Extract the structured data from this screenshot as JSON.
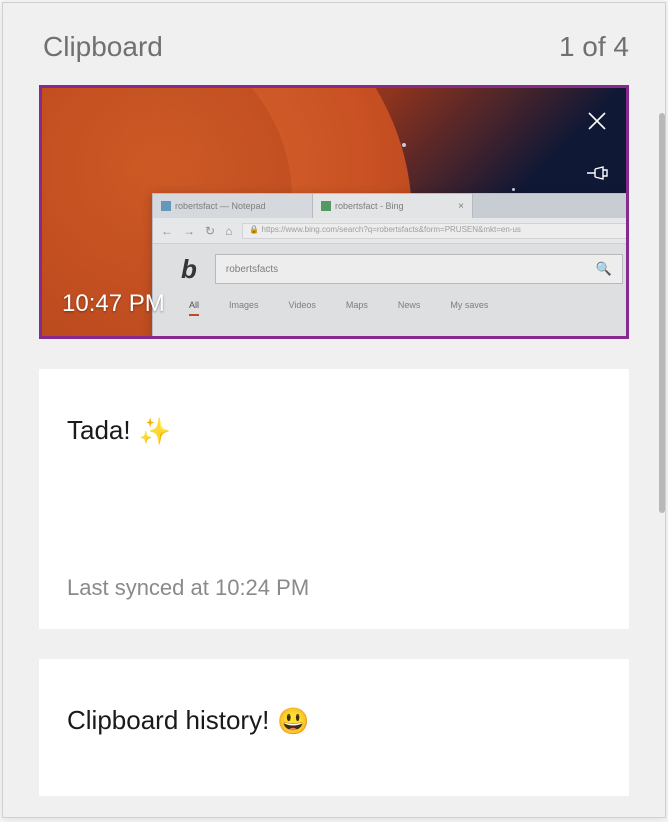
{
  "header": {
    "title": "Clipboard",
    "counter": "1 of 4"
  },
  "items": [
    {
      "type": "image",
      "timestamp": "10:47 PM",
      "selected": true,
      "browser_tab1": "robertsfact — Notepad",
      "browser_tab2": "robertsfact - Bing",
      "browser_search_text": "robertsfacts",
      "actions": {
        "close": "close-icon",
        "pin": "pin-icon"
      }
    },
    {
      "type": "text",
      "content": "Tada!",
      "emoji": "✨",
      "synced_label": "Last synced at 10:24 PM"
    },
    {
      "type": "text",
      "content": "Clipboard history!",
      "emoji": "😃"
    }
  ],
  "colors": {
    "selection_border": "#862a8e"
  }
}
